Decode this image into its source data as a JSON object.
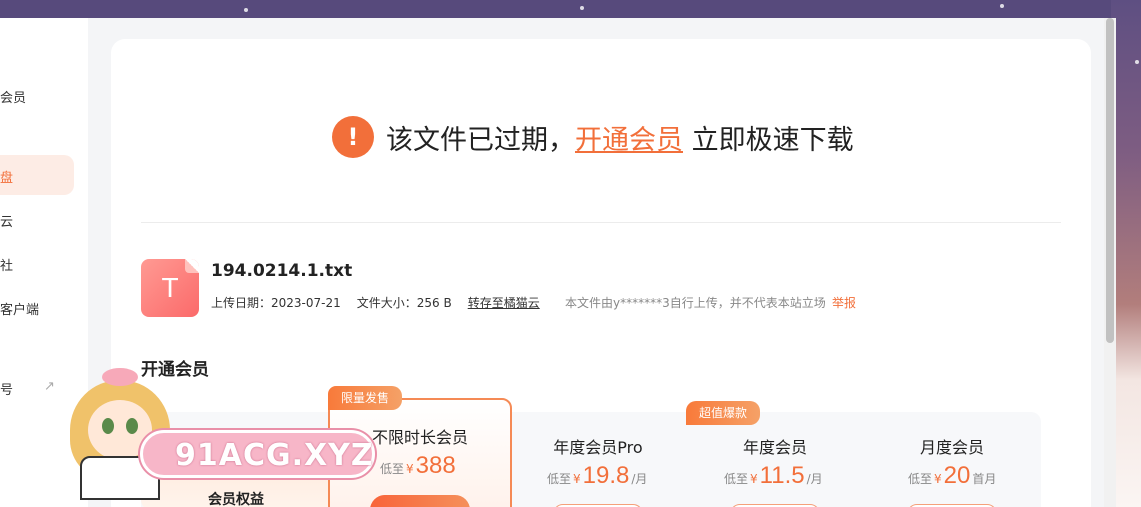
{
  "sidebar": {
    "items": [
      {
        "label": "会员"
      },
      {
        "label": "盘",
        "active": true
      },
      {
        "label": "云"
      },
      {
        "label": "社"
      },
      {
        "label": "客户端"
      },
      {
        "label": "号"
      }
    ]
  },
  "notice_bar": {
    "text_before": "该文件已过期，",
    "link_text": "开通会员",
    "text_after": " 立即极速下载"
  },
  "file": {
    "icon_letter": "T",
    "name": "194.0214.1.txt",
    "upload_date": "上传日期：2023-07-21",
    "size": "文件大小：256 B",
    "save_link": "转存至橘猫云",
    "uploader_notice": "本文件由y*******3自行上传，并不代表本站立场",
    "report_label": "举报"
  },
  "membership": {
    "section_title": "开通会员",
    "benefits_label": "会员权益",
    "plans": [
      {
        "tag": "限量发售",
        "name": "不限时长会员",
        "prefix": "低至",
        "currency": "¥",
        "price": "388",
        "suffix": ""
      },
      {
        "tag": "",
        "name": "年度会员Pro",
        "prefix": "低至",
        "currency": "¥",
        "price": "19.8",
        "suffix": "/月"
      },
      {
        "tag": "超值爆款",
        "name": "年度会员",
        "prefix": "低至",
        "currency": "¥",
        "price": "11.5",
        "suffix": "/月"
      },
      {
        "tag": "",
        "name": "月度会员",
        "prefix": "低至",
        "currency": "¥",
        "price": "20",
        "suffix": "首月"
      }
    ]
  },
  "watermark": {
    "text": "91ACG.XYZ"
  },
  "colors": {
    "accent": "#f26f3a",
    "background": "#5b4f7e"
  }
}
